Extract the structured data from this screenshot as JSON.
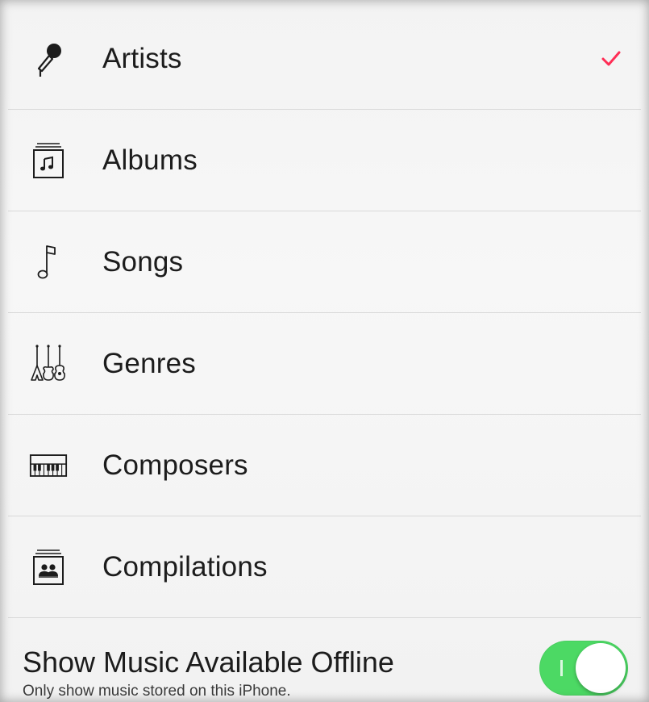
{
  "menu": {
    "items": [
      {
        "label": "Artists",
        "icon": "microphone-icon",
        "selected": true
      },
      {
        "label": "Albums",
        "icon": "album-icon",
        "selected": false
      },
      {
        "label": "Songs",
        "icon": "music-note-icon",
        "selected": false
      },
      {
        "label": "Genres",
        "icon": "guitars-icon",
        "selected": false
      },
      {
        "label": "Composers",
        "icon": "piano-keyboard-icon",
        "selected": false
      },
      {
        "label": "Compilations",
        "icon": "compilation-icon",
        "selected": false
      }
    ]
  },
  "offline": {
    "title": "Show Music Available Offline",
    "subtitle": "Only show music stored on this iPhone.",
    "enabled": true
  },
  "colors": {
    "accent": "#ff2d55",
    "toggle_on": "#4cd964",
    "text": "#1c1c1c",
    "separator": "#d9d9d9"
  }
}
